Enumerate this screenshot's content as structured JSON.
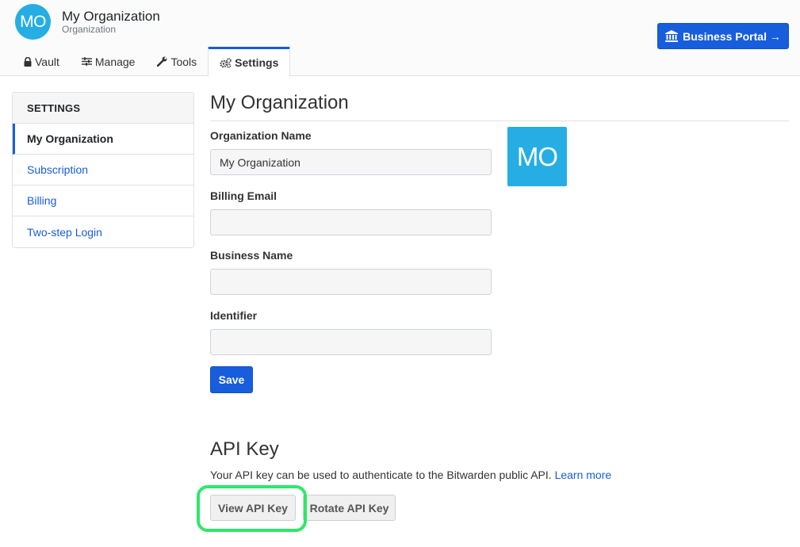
{
  "header": {
    "avatar_initials": "MO",
    "org_name": "My Organization",
    "org_type": "Organization",
    "portal_button": "Business Portal →",
    "tabs": [
      {
        "label": "Vault",
        "icon": "lock-icon"
      },
      {
        "label": "Manage",
        "icon": "sliders-icon"
      },
      {
        "label": "Tools",
        "icon": "wrench-icon"
      },
      {
        "label": "Settings",
        "icon": "gears-icon",
        "active": true
      }
    ]
  },
  "sidebar": {
    "heading": "SETTINGS",
    "items": [
      {
        "label": "My Organization",
        "active": true
      },
      {
        "label": "Subscription"
      },
      {
        "label": "Billing"
      },
      {
        "label": "Two-step Login"
      }
    ]
  },
  "main": {
    "title": "My Organization",
    "logo_initials": "MO",
    "fields": [
      {
        "label": "Organization Name",
        "value": "My Organization"
      },
      {
        "label": "Billing Email",
        "value": ""
      },
      {
        "label": "Business Name",
        "value": ""
      },
      {
        "label": "Identifier",
        "value": ""
      }
    ],
    "save_label": "Save"
  },
  "api": {
    "title": "API Key",
    "description": "Your API key can be used to authenticate to the Bitwarden public API.",
    "learn_more": "Learn more",
    "view_label": "View API Key",
    "rotate_label": "Rotate API Key"
  },
  "colors": {
    "primary": "#175ddc",
    "avatar": "#26aee4",
    "highlight": "#2ee86a"
  }
}
